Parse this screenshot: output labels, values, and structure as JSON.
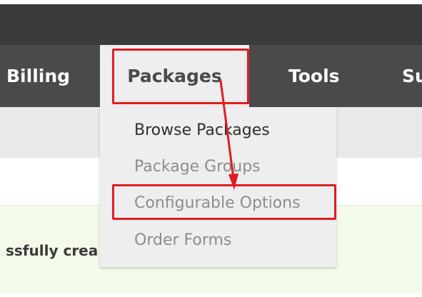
{
  "nav": {
    "items": [
      {
        "label": "Billing"
      },
      {
        "label": "Packages"
      },
      {
        "label": "Tools"
      },
      {
        "label": "Su"
      }
    ]
  },
  "dropdown": {
    "items": [
      {
        "label": "Browse Packages"
      },
      {
        "label": "Package Groups"
      },
      {
        "label": "Configurable Options"
      },
      {
        "label": "Order Forms"
      }
    ]
  },
  "notice": {
    "text": "ssfully crea"
  },
  "colors": {
    "header_dark": "#3b3b3b",
    "nav_bg": "#4a4a4a",
    "dropdown_bg": "#eeeeee",
    "highlight_red": "#e31b23",
    "notice_bg": "#f3fae9"
  }
}
